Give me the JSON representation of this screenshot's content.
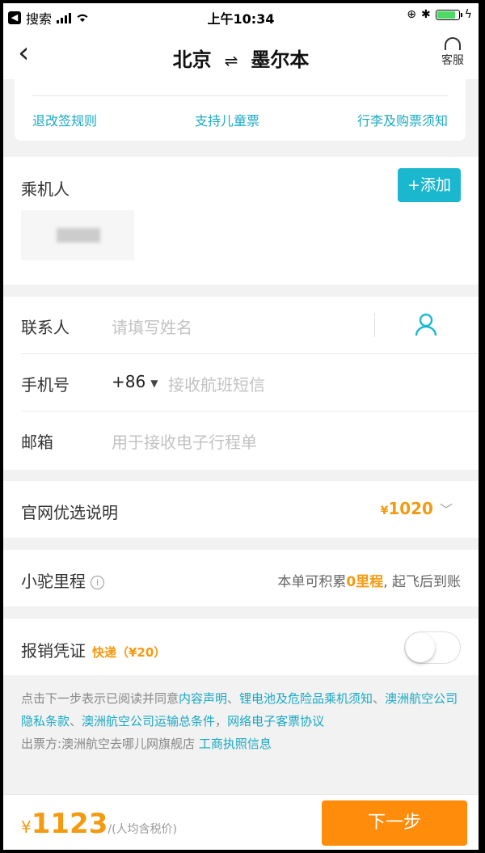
{
  "status_bar": {
    "carrier": "搜索",
    "time": "上午10:34"
  },
  "nav": {
    "back": "‹",
    "from": "北京",
    "swap": "⇌",
    "to": "墨尔本",
    "service": "客服"
  },
  "links": [
    "退改签规则",
    "支持儿童票",
    "行李及购票须知"
  ],
  "passengers": {
    "label": "乘机人",
    "add": "+添加"
  },
  "contact": {
    "name_label": "联系人",
    "name_placeholder": "请填写姓名",
    "phone_label": "手机号",
    "country_code": "+86",
    "phone_placeholder": "接收航班短信",
    "email_label": "邮箱",
    "email_placeholder": "用于接收电子行程单"
  },
  "official": {
    "label": "官网优选说明",
    "currency": "¥",
    "price": "1020"
  },
  "mileage": {
    "label": "小驼里程",
    "pre": "本单可积累",
    "highlight": "0里程",
    "post": ", 起飞后到账"
  },
  "invoice": {
    "label": "报销凭证",
    "express": "快递（¥20）",
    "enabled": false
  },
  "notice": {
    "pre": "点击下一步表示已阅读并同意",
    "link1": "内容声明",
    "sep1": "、",
    "link2": "锂电池及危险品乘机须知",
    "sep2": "、",
    "link3": "澳洲航空公司隐私条款",
    "sep3": "、",
    "link4": "澳洲航空公司运输总条件",
    "sep4": "，",
    "link5": "网络电子客票协议",
    "issuer": "出票方:澳洲航空去哪儿网旗舰店 ",
    "link6": "工商执照信息"
  },
  "footer": {
    "currency": "¥",
    "total": "1123",
    "note": "/(人均含税价)",
    "next": "下一步"
  },
  "colors": {
    "accent": "#1bb7cf",
    "orange": "#f39a10",
    "button": "#ff8c0a"
  }
}
